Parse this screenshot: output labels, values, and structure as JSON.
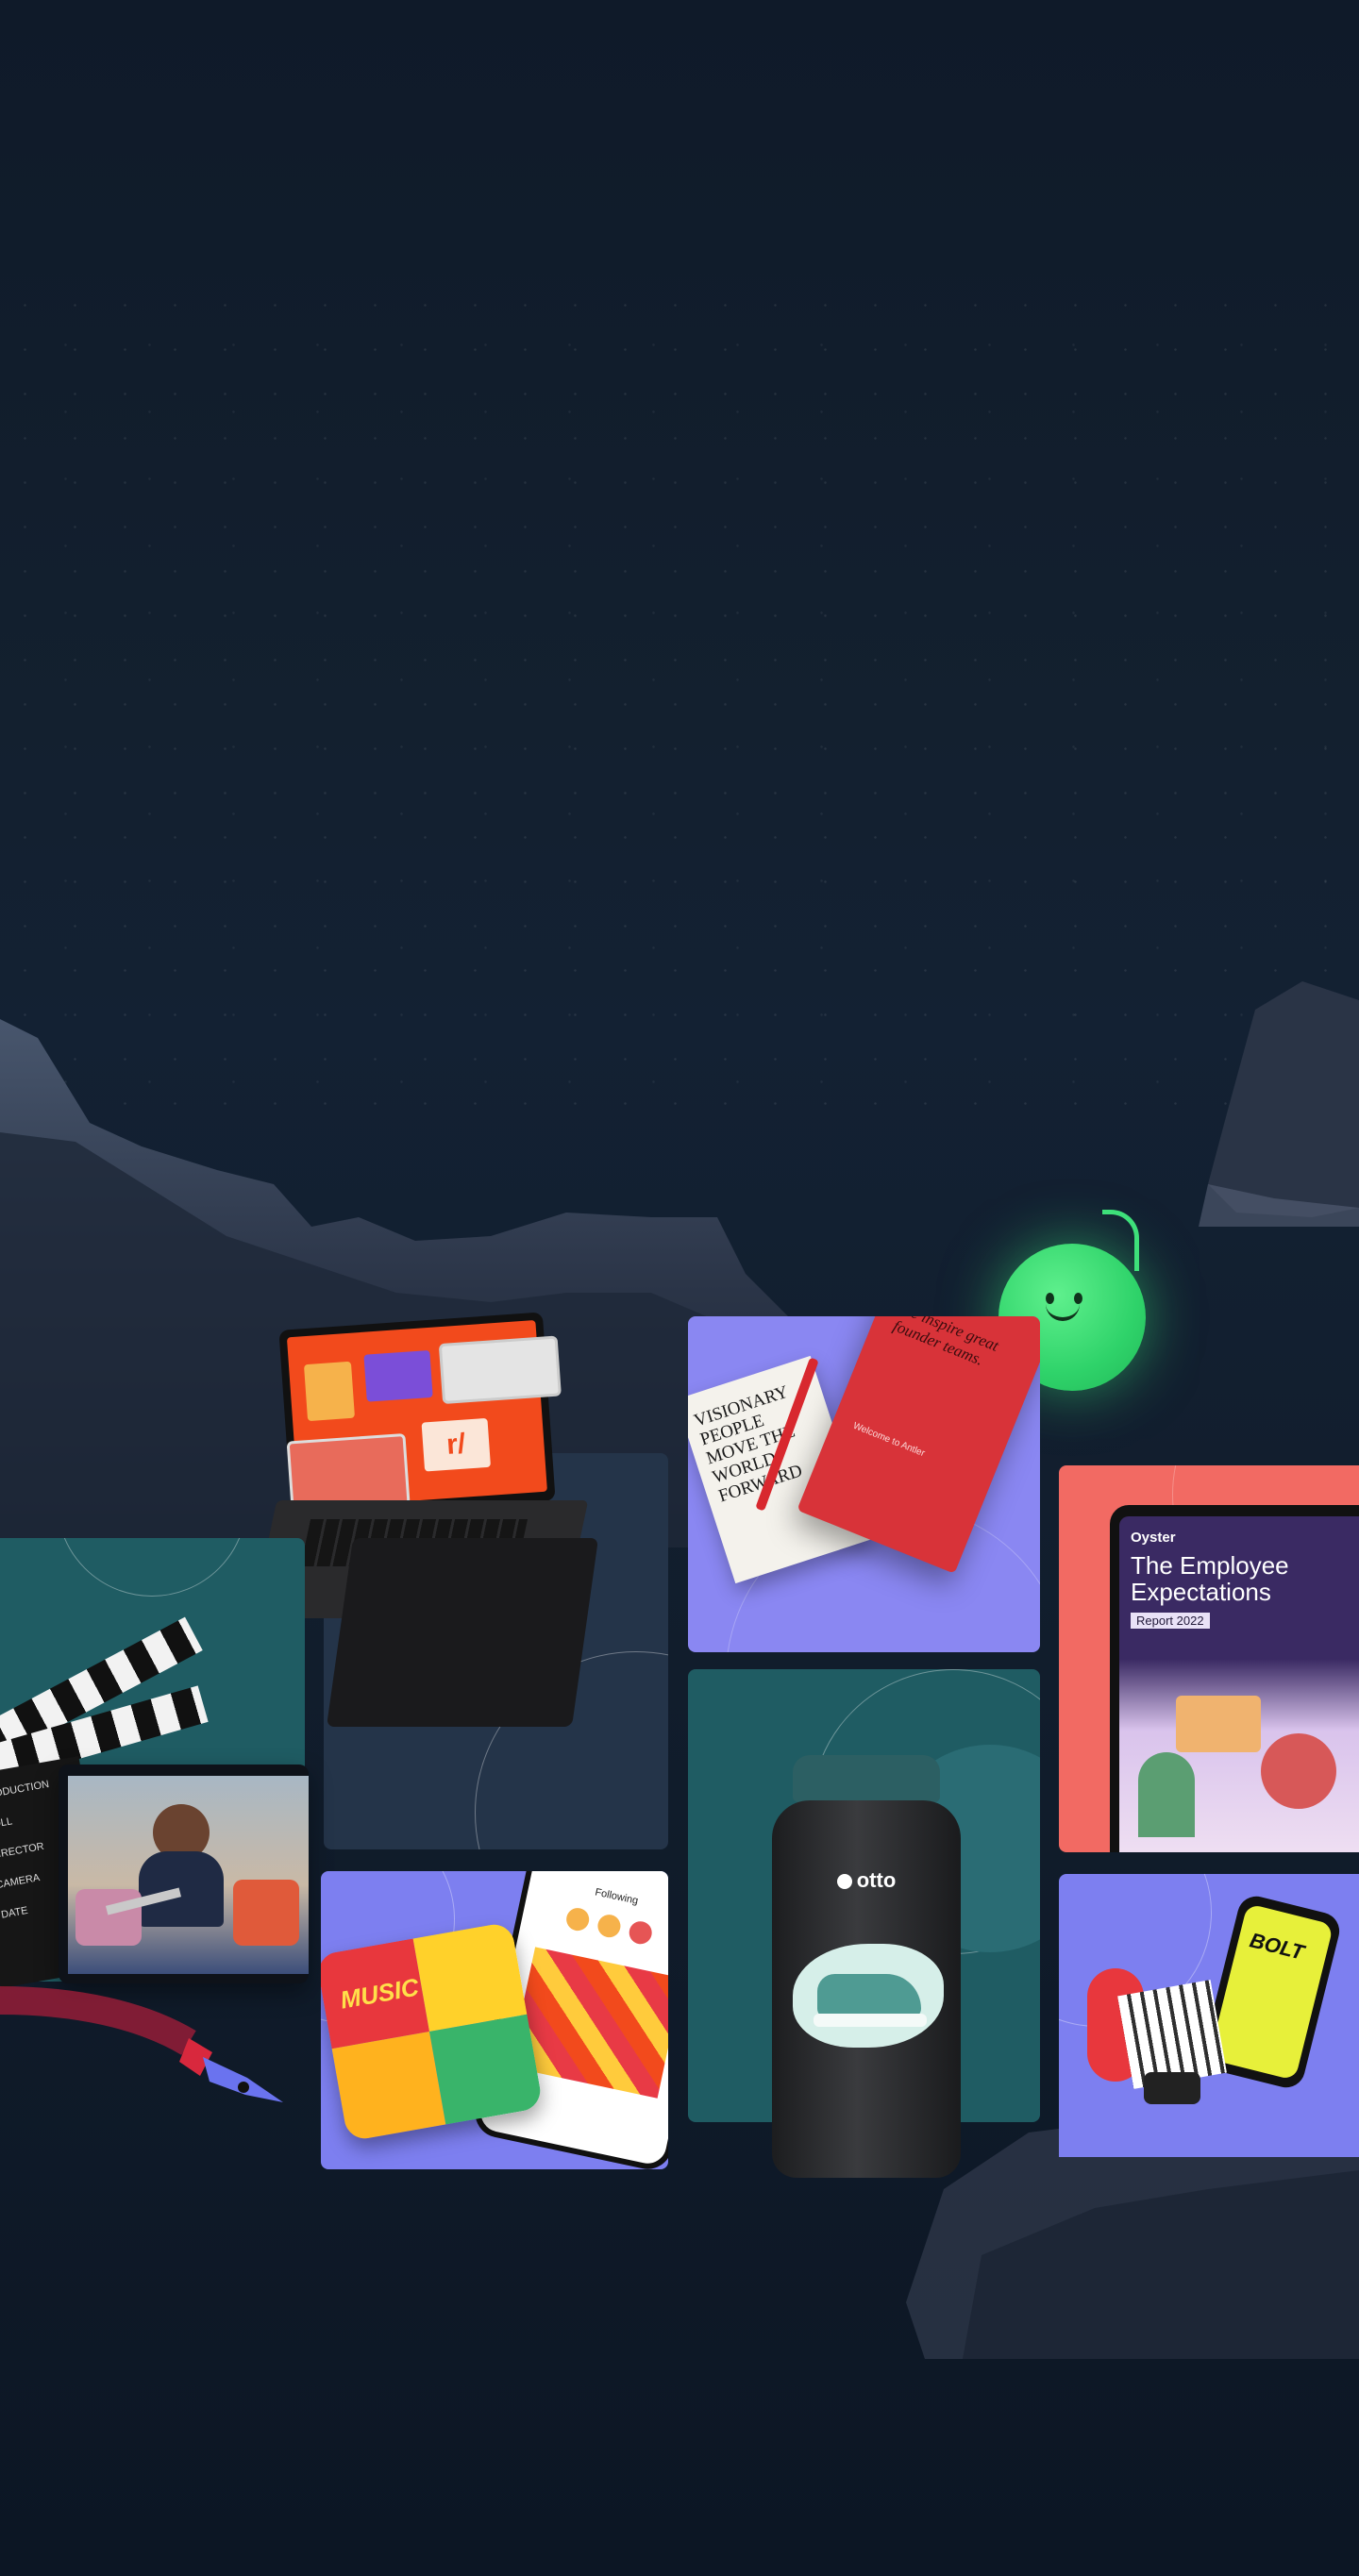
{
  "colors": {
    "background": "#0e1927",
    "tile_teal": "#1f5c63",
    "tile_slate": "#243449",
    "tile_violet": "#7d7ff0",
    "tile_coral": "#f26a63",
    "mascot_green": "#3ee07a",
    "laptop_screen": "#f24a1c"
  },
  "tiles": {
    "book": {
      "icon": "book-and-notebook-image",
      "book_title": "VISIONARY PEOPLE MOVE THE WORLD FORWARD",
      "notebook_text": "We inspire great founder teams.",
      "notebook_footer": "Welcome to Antler"
    },
    "bottle": {
      "icon": "water-bottle-image",
      "brand": "otto"
    },
    "report": {
      "icon": "tablet-report-image",
      "brand": "Oyster",
      "title": "The Employee Expectations",
      "subtitle": "Report 2022"
    },
    "music": {
      "icon": "music-app-image",
      "card_title": "MUSIC",
      "feed_tab": "Following"
    },
    "bolt": {
      "icon": "bolt-phone-image",
      "brand": "BOLT"
    },
    "laptop": {
      "icon": "laptop-reddit-image",
      "screen_logo": "r/"
    },
    "video": {
      "icon": "clapperboard-video-image",
      "clapper_lines": [
        "PRODUCTION",
        "ROLL",
        "DIRECTOR",
        "CAMERA",
        "DATE"
      ]
    }
  },
  "decor": {
    "mascot": "smiling-green-mascot-icon",
    "pen": "pen-nib-icon",
    "rock": "rock-mountain-decor"
  }
}
